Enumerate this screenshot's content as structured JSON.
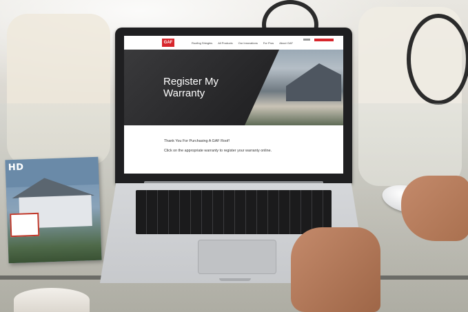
{
  "site": {
    "logo_text": "GAF",
    "nav_items": [
      "Roofing Shingles",
      "All Products",
      "Our Innovations",
      "For Pros",
      "About GAF"
    ]
  },
  "hero": {
    "title": "Register My Warranty"
  },
  "content": {
    "thanks": "Thank You For Purchasing A GAF Roof!",
    "instructions": "Click on the appropriate warranty to register your warranty online."
  },
  "magazine": {
    "title": "HD"
  },
  "colors": {
    "brand_red": "#d7262c",
    "hero_dark": "#242426"
  }
}
